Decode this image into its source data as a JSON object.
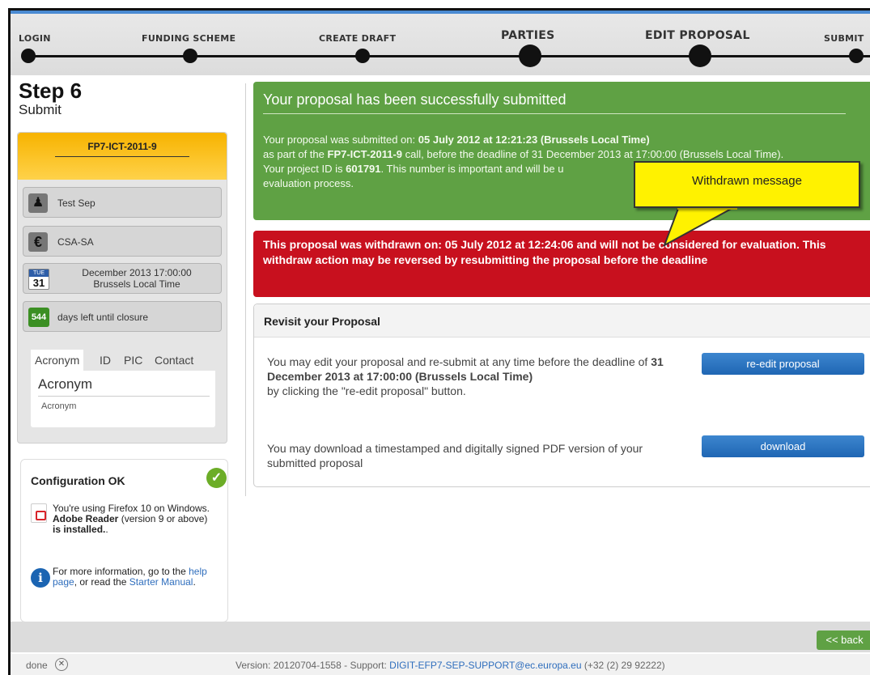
{
  "steps": [
    {
      "label": "LOGIN"
    },
    {
      "label": "FUNDING SCHEME"
    },
    {
      "label": "CREATE DRAFT"
    },
    {
      "label": "PARTIES"
    },
    {
      "label": "EDIT PROPOSAL"
    },
    {
      "label": "SUBMIT"
    }
  ],
  "left": {
    "step_title": "Step 6",
    "step_subtitle": "Submit",
    "call_id": "FP7-ICT-2011-9",
    "user": "Test Sep",
    "funding": "CSA-SA",
    "calendar_month": "TUE",
    "calendar_day": "31",
    "deadline_line1": "December 2013 17:00:00",
    "deadline_line2": "Brussels Local Time",
    "days_left": "544",
    "days_left_label": "days left until closure",
    "tabs": [
      "Acronym",
      "ID",
      "PIC",
      "Contact"
    ],
    "acronym_title": "Acronym",
    "acronym_value": "Acronym"
  },
  "config": {
    "title": "Configuration OK",
    "reader_pre": "You're using Firefox 10 on Windows.",
    "reader_bold1": "Adobe Reader",
    "reader_mid": "(version 9 or above)",
    "reader_bold2": "is installed.",
    "reader_end": ".",
    "info_pre": "For more information, go to the",
    "help_link": "help page",
    "info_mid": ", or read the",
    "manual_link": "Starter Manual",
    "info_end": "."
  },
  "success": {
    "title": "Your proposal has been successfully submitted",
    "l1_pre": "Your proposal was submitted on:",
    "l1_bold": "05 July 2012 at 12:21:23 (Brussels Local Time)",
    "l2_pre": "as part of the",
    "l2_bold": "FP7-ICT-2011-9",
    "l2_post": "call, before the deadline of 31 December 2013 at 17:00:00 (Brussels Local Time).",
    "l3_pre": "Your project ID is",
    "l3_bold": "601791",
    "l3_post": ". This number is important and will be u",
    "l4": "evaluation process."
  },
  "callout": "Withdrawn message",
  "withdrawn": "This proposal was withdrawn on: 05 July 2012 at 12:24:06 and will not be considered for evaluation. This withdraw action may be reversed by resubmitting the proposal before the deadline",
  "revisit": {
    "title": "Revisit your Proposal",
    "edit_pre": "You may edit your proposal and re-submit at any time before the deadline of",
    "edit_bold": "31 December 2013 at 17:00:00 (Brussels Local Time)",
    "edit_post": "by clicking the \"re-edit proposal\" button.",
    "reedit_label": "re-edit proposal",
    "download_text": "You may download a timestamped and digitally signed PDF version of your submitted proposal",
    "download_label": "download"
  },
  "footer": {
    "back_label": "<< back",
    "status": "done",
    "version_pre": "Version: 20120704-1558 - Support:",
    "support_email": "DIGIT-EFP7-SEP-SUPPORT@ec.europa.eu",
    "version_post": "(+32 (2) 29 92222)"
  }
}
